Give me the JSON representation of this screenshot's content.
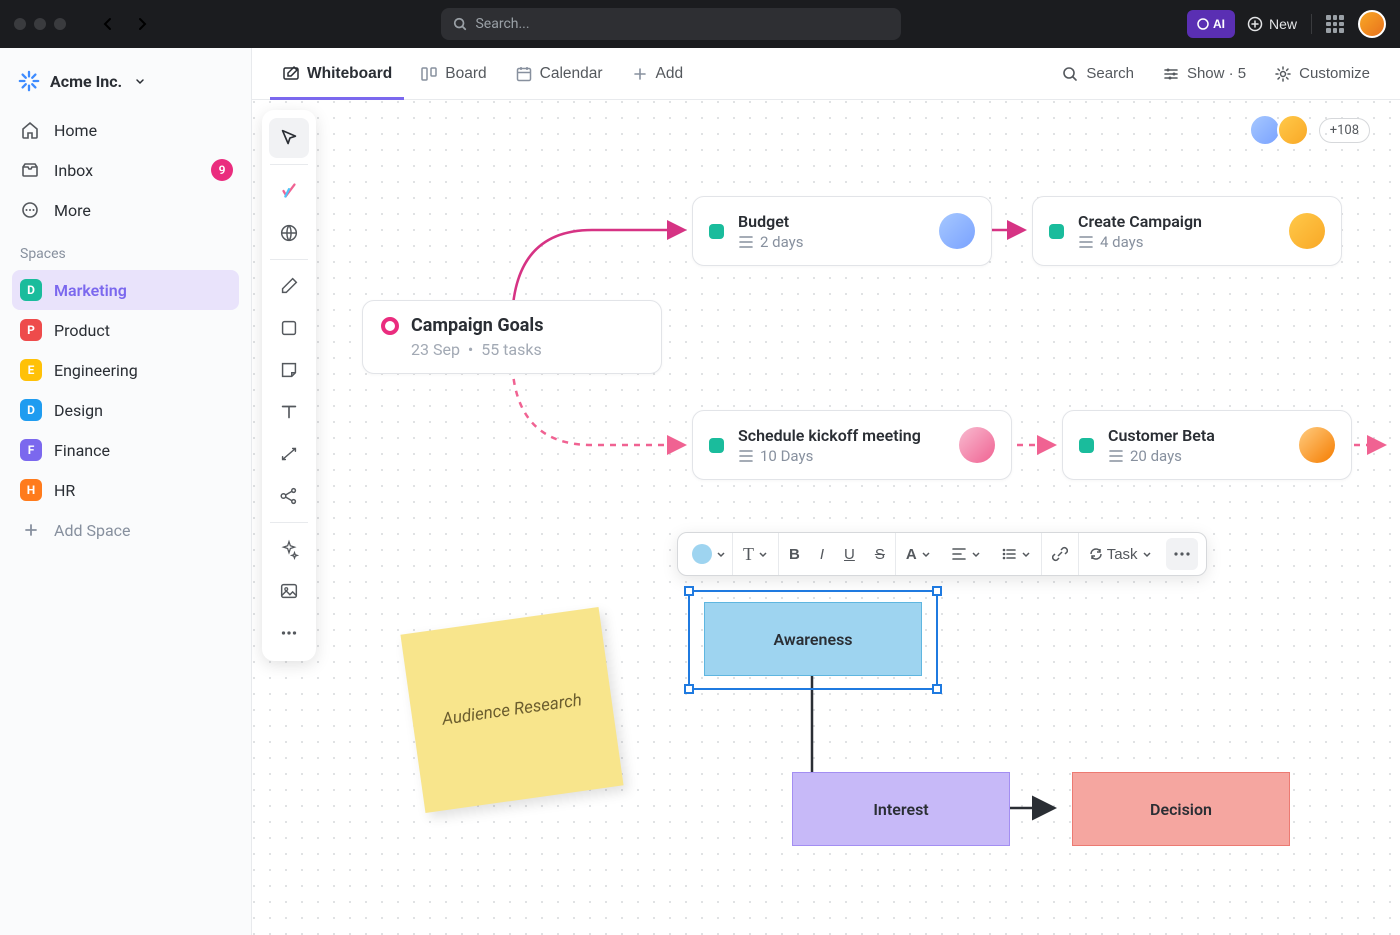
{
  "topbar": {
    "search_placeholder": "Search...",
    "ai_label": "AI",
    "new_label": "New"
  },
  "workspace": {
    "name": "Acme Inc."
  },
  "nav": {
    "home": "Home",
    "inbox": "Inbox",
    "inbox_badge": "9",
    "more": "More"
  },
  "spaces_header": "Spaces",
  "spaces": [
    {
      "code": "D",
      "label": "Marketing",
      "color": "#1abc9c",
      "active": true
    },
    {
      "code": "P",
      "label": "Product",
      "color": "#ee4b4b"
    },
    {
      "code": "E",
      "label": "Engineering",
      "color": "#ffc107"
    },
    {
      "code": "D",
      "label": "Design",
      "color": "#1f9cf0"
    },
    {
      "code": "F",
      "label": "Finance",
      "color": "#7b68ee"
    },
    {
      "code": "H",
      "label": "HR",
      "color": "#ff7b1c"
    }
  ],
  "add_space": "Add Space",
  "view_tabs": {
    "whiteboard": "Whiteboard",
    "board": "Board",
    "calendar": "Calendar",
    "add": "Add",
    "search": "Search",
    "show": "Show · 5",
    "customize": "Customize"
  },
  "collaborators_more": "+108",
  "cards": {
    "goals": {
      "title": "Campaign Goals",
      "date": "23 Sep",
      "tasks": "55 tasks"
    },
    "budget": {
      "title": "Budget",
      "sub": "2 days"
    },
    "create": {
      "title": "Create Campaign",
      "sub": "4 days"
    },
    "kickoff": {
      "title": "Schedule kickoff meeting",
      "sub": "10 Days"
    },
    "beta": {
      "title": "Customer Beta",
      "sub": "20 days"
    }
  },
  "rt_toolbar": {
    "task_label": "Task"
  },
  "shapes": {
    "awareness": "Awareness",
    "interest": "Interest",
    "decision": "Decision"
  },
  "sticky": "Audience Research"
}
